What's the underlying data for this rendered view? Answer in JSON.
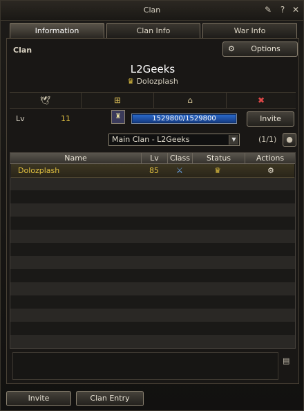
{
  "window": {
    "title": "Clan"
  },
  "tabs": [
    {
      "label": "Information"
    },
    {
      "label": "Clan Info"
    },
    {
      "label": "War Info"
    }
  ],
  "section_label": "Clan",
  "options_label": "Options",
  "clan": {
    "name": "L2Geeks",
    "leader": "Dolozplash"
  },
  "level": {
    "label": "Lv",
    "value": "11"
  },
  "exp": {
    "text": "1529800/1529800",
    "fill_fraction": 1.0
  },
  "invite_label": "Invite",
  "subclan": {
    "selected": "Main Clan - L2Geeks",
    "count": "(1/1)"
  },
  "table": {
    "headers": {
      "name": "Name",
      "lv": "Lv",
      "class": "Class",
      "status": "Status",
      "actions": "Actions"
    },
    "rows": [
      {
        "name": "Dolozplash",
        "lv": "85"
      }
    ]
  },
  "bottom": {
    "invite": "Invite",
    "clan_entry": "Clan Entry"
  },
  "colors": {
    "accent_gold": "#e0c040",
    "exp_blue": "#1d4fa6"
  }
}
